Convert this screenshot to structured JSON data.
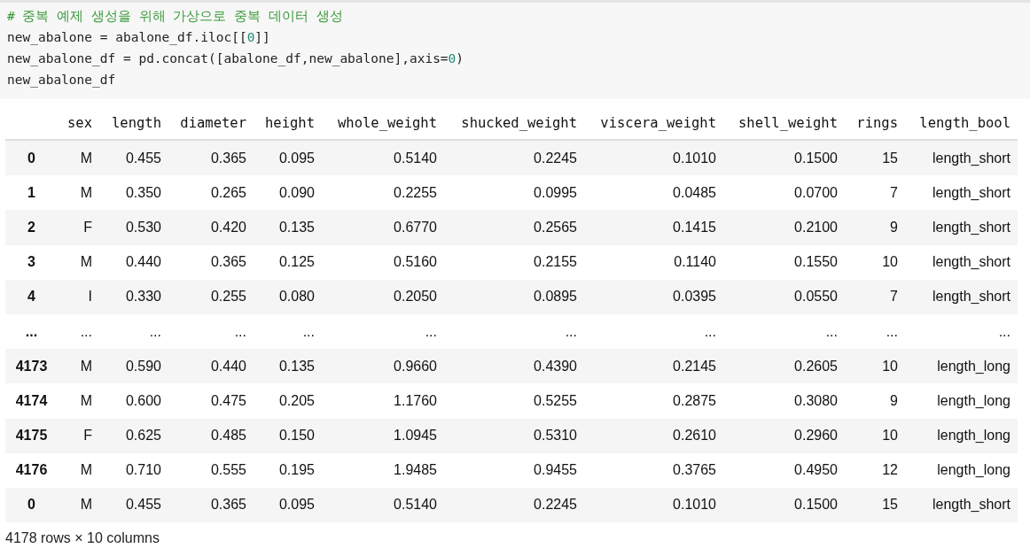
{
  "code": {
    "lines": [
      [
        {
          "kind": "comment",
          "text": "# 중복 예제 생성을 위해 가상으로 중복 데이터 생성"
        }
      ],
      [
        {
          "kind": "plain",
          "text": "new_abalone = abalone_df.iloc[["
        },
        {
          "kind": "number",
          "text": "0"
        },
        {
          "kind": "plain",
          "text": "]]"
        }
      ],
      [
        {
          "kind": "plain",
          "text": "new_abalone_df = pd.concat([abalone_df,new_abalone],axis="
        },
        {
          "kind": "number",
          "text": "0"
        },
        {
          "kind": "plain",
          "text": ")"
        }
      ],
      [
        {
          "kind": "plain",
          "text": "new_abalone_df"
        }
      ]
    ]
  },
  "table": {
    "columns": [
      "sex",
      "length",
      "diameter",
      "height",
      "whole_weight",
      "shucked_weight",
      "viscera_weight",
      "shell_weight",
      "rings",
      "length_bool"
    ],
    "rows": [
      {
        "index": "0",
        "cells": [
          "M",
          "0.455",
          "0.365",
          "0.095",
          "0.5140",
          "0.2245",
          "0.1010",
          "0.1500",
          "15",
          "length_short"
        ]
      },
      {
        "index": "1",
        "cells": [
          "M",
          "0.350",
          "0.265",
          "0.090",
          "0.2255",
          "0.0995",
          "0.0485",
          "0.0700",
          "7",
          "length_short"
        ]
      },
      {
        "index": "2",
        "cells": [
          "F",
          "0.530",
          "0.420",
          "0.135",
          "0.6770",
          "0.2565",
          "0.1415",
          "0.2100",
          "9",
          "length_short"
        ]
      },
      {
        "index": "3",
        "cells": [
          "M",
          "0.440",
          "0.365",
          "0.125",
          "0.5160",
          "0.2155",
          "0.1140",
          "0.1550",
          "10",
          "length_short"
        ]
      },
      {
        "index": "4",
        "cells": [
          "I",
          "0.330",
          "0.255",
          "0.080",
          "0.2050",
          "0.0895",
          "0.0395",
          "0.0550",
          "7",
          "length_short"
        ]
      },
      {
        "index": "...",
        "cells": [
          "...",
          "...",
          "...",
          "...",
          "...",
          "...",
          "...",
          "...",
          "...",
          "..."
        ]
      },
      {
        "index": "4173",
        "cells": [
          "M",
          "0.590",
          "0.440",
          "0.135",
          "0.9660",
          "0.4390",
          "0.2145",
          "0.2605",
          "10",
          "length_long"
        ]
      },
      {
        "index": "4174",
        "cells": [
          "M",
          "0.600",
          "0.475",
          "0.205",
          "1.1760",
          "0.5255",
          "0.2875",
          "0.3080",
          "9",
          "length_long"
        ]
      },
      {
        "index": "4175",
        "cells": [
          "F",
          "0.625",
          "0.485",
          "0.150",
          "1.0945",
          "0.5310",
          "0.2610",
          "0.2960",
          "10",
          "length_long"
        ]
      },
      {
        "index": "4176",
        "cells": [
          "M",
          "0.710",
          "0.555",
          "0.195",
          "1.9485",
          "0.9455",
          "0.3765",
          "0.4950",
          "12",
          "length_long"
        ]
      },
      {
        "index": "0",
        "cells": [
          "M",
          "0.455",
          "0.365",
          "0.095",
          "0.5140",
          "0.2245",
          "0.1010",
          "0.1500",
          "15",
          "length_short"
        ]
      }
    ]
  },
  "footer": "4178 rows × 10 columns"
}
